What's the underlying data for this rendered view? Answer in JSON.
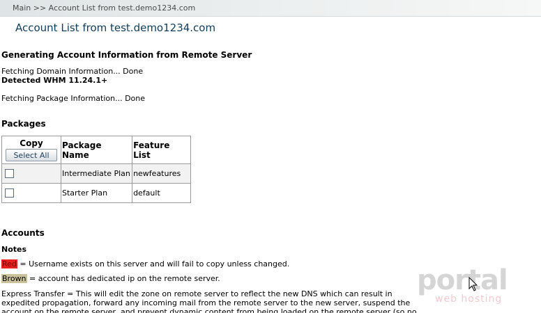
{
  "breadcrumb": "Main >> Account List from test.demo1234.com",
  "page_title": "Account List from test.demo1234.com",
  "generating": {
    "title": "Generating Account Information from Remote Server",
    "fetch_domain": "Fetching Domain Information... Done",
    "detected": "Detected WHM 11.24.1+",
    "fetch_package": "Fetching Package Information... Done"
  },
  "packages": {
    "title": "Packages",
    "headers": {
      "copy": "Copy",
      "package_name": "Package Name",
      "feature_list": "Feature List"
    },
    "select_all_label": "Select All",
    "rows": [
      {
        "name": "Intermediate Plan",
        "features": "newfeatures"
      },
      {
        "name": "Starter Plan",
        "features": "default"
      }
    ]
  },
  "accounts": {
    "title": "Accounts",
    "notes_title": "Notes",
    "red_label": "Red",
    "red_text": " = Username exists on this server and will fail to copy unless changed.",
    "brown_label": "Brown",
    "brown_text": " = account has dedicated ip on the remote server.",
    "express_transfer": "Express Transfer = This will edit the zone on remote server to reflect the new DNS which can result in expedited propagation, forward any incoming mail from the remote server to the new server, suspend the account on the remote server, and prevent dynamic content from being loaded on the remote server (so no"
  },
  "watermark": {
    "main": "portal",
    "sub": "web hosting"
  },
  "colors": {
    "title_blue": "#0e3d5c",
    "red_swatch": "#e8201e",
    "brown_swatch": "#c9c29a"
  }
}
